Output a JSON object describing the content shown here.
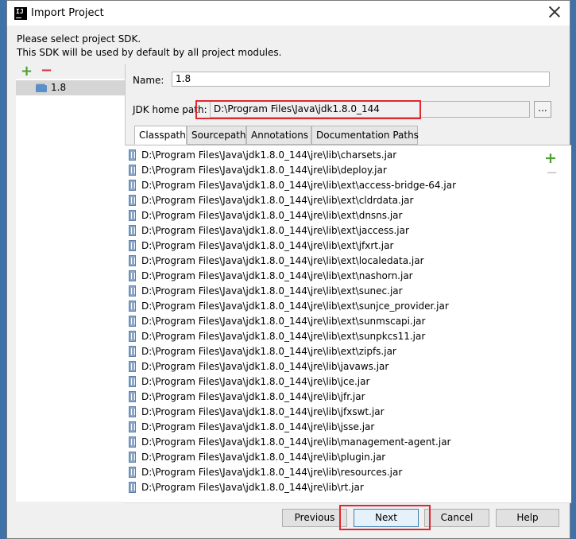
{
  "window": {
    "title": "Import Project",
    "app_icon_text": "IJ"
  },
  "message": {
    "line1": "Please select project SDK.",
    "line2": "This SDK will be used by default by all project modules."
  },
  "sdk_list": {
    "items": [
      {
        "label": "1.8",
        "selected": true
      }
    ]
  },
  "form": {
    "name_label": "Name:",
    "name_value": "1.8",
    "jdk_label": "JDK home path:",
    "jdk_value": "D:\\Program Files\\Java\\jdk1.8.0_144",
    "browse_label": "..."
  },
  "tabs": [
    {
      "label": "Classpath",
      "active": true
    },
    {
      "label": "Sourcepath",
      "active": false
    },
    {
      "label": "Annotations",
      "active": false
    },
    {
      "label": "Documentation Paths",
      "active": false
    }
  ],
  "classpath": [
    "D:\\Program Files\\Java\\jdk1.8.0_144\\jre\\lib\\charsets.jar",
    "D:\\Program Files\\Java\\jdk1.8.0_144\\jre\\lib\\deploy.jar",
    "D:\\Program Files\\Java\\jdk1.8.0_144\\jre\\lib\\ext\\access-bridge-64.jar",
    "D:\\Program Files\\Java\\jdk1.8.0_144\\jre\\lib\\ext\\cldrdata.jar",
    "D:\\Program Files\\Java\\jdk1.8.0_144\\jre\\lib\\ext\\dnsns.jar",
    "D:\\Program Files\\Java\\jdk1.8.0_144\\jre\\lib\\ext\\jaccess.jar",
    "D:\\Program Files\\Java\\jdk1.8.0_144\\jre\\lib\\ext\\jfxrt.jar",
    "D:\\Program Files\\Java\\jdk1.8.0_144\\jre\\lib\\ext\\localedata.jar",
    "D:\\Program Files\\Java\\jdk1.8.0_144\\jre\\lib\\ext\\nashorn.jar",
    "D:\\Program Files\\Java\\jdk1.8.0_144\\jre\\lib\\ext\\sunec.jar",
    "D:\\Program Files\\Java\\jdk1.8.0_144\\jre\\lib\\ext\\sunjce_provider.jar",
    "D:\\Program Files\\Java\\jdk1.8.0_144\\jre\\lib\\ext\\sunmscapi.jar",
    "D:\\Program Files\\Java\\jdk1.8.0_144\\jre\\lib\\ext\\sunpkcs11.jar",
    "D:\\Program Files\\Java\\jdk1.8.0_144\\jre\\lib\\ext\\zipfs.jar",
    "D:\\Program Files\\Java\\jdk1.8.0_144\\jre\\lib\\javaws.jar",
    "D:\\Program Files\\Java\\jdk1.8.0_144\\jre\\lib\\jce.jar",
    "D:\\Program Files\\Java\\jdk1.8.0_144\\jre\\lib\\jfr.jar",
    "D:\\Program Files\\Java\\jdk1.8.0_144\\jre\\lib\\jfxswt.jar",
    "D:\\Program Files\\Java\\jdk1.8.0_144\\jre\\lib\\jsse.jar",
    "D:\\Program Files\\Java\\jdk1.8.0_144\\jre\\lib\\management-agent.jar",
    "D:\\Program Files\\Java\\jdk1.8.0_144\\jre\\lib\\plugin.jar",
    "D:\\Program Files\\Java\\jdk1.8.0_144\\jre\\lib\\resources.jar",
    "D:\\Program Files\\Java\\jdk1.8.0_144\\jre\\lib\\rt.jar"
  ],
  "buttons": {
    "previous": "Previous",
    "next": "Next",
    "cancel": "Cancel",
    "help": "Help"
  },
  "colors": {
    "add": "#4aa031",
    "remove": "#d13a3a",
    "highlight": "#e0262e"
  }
}
